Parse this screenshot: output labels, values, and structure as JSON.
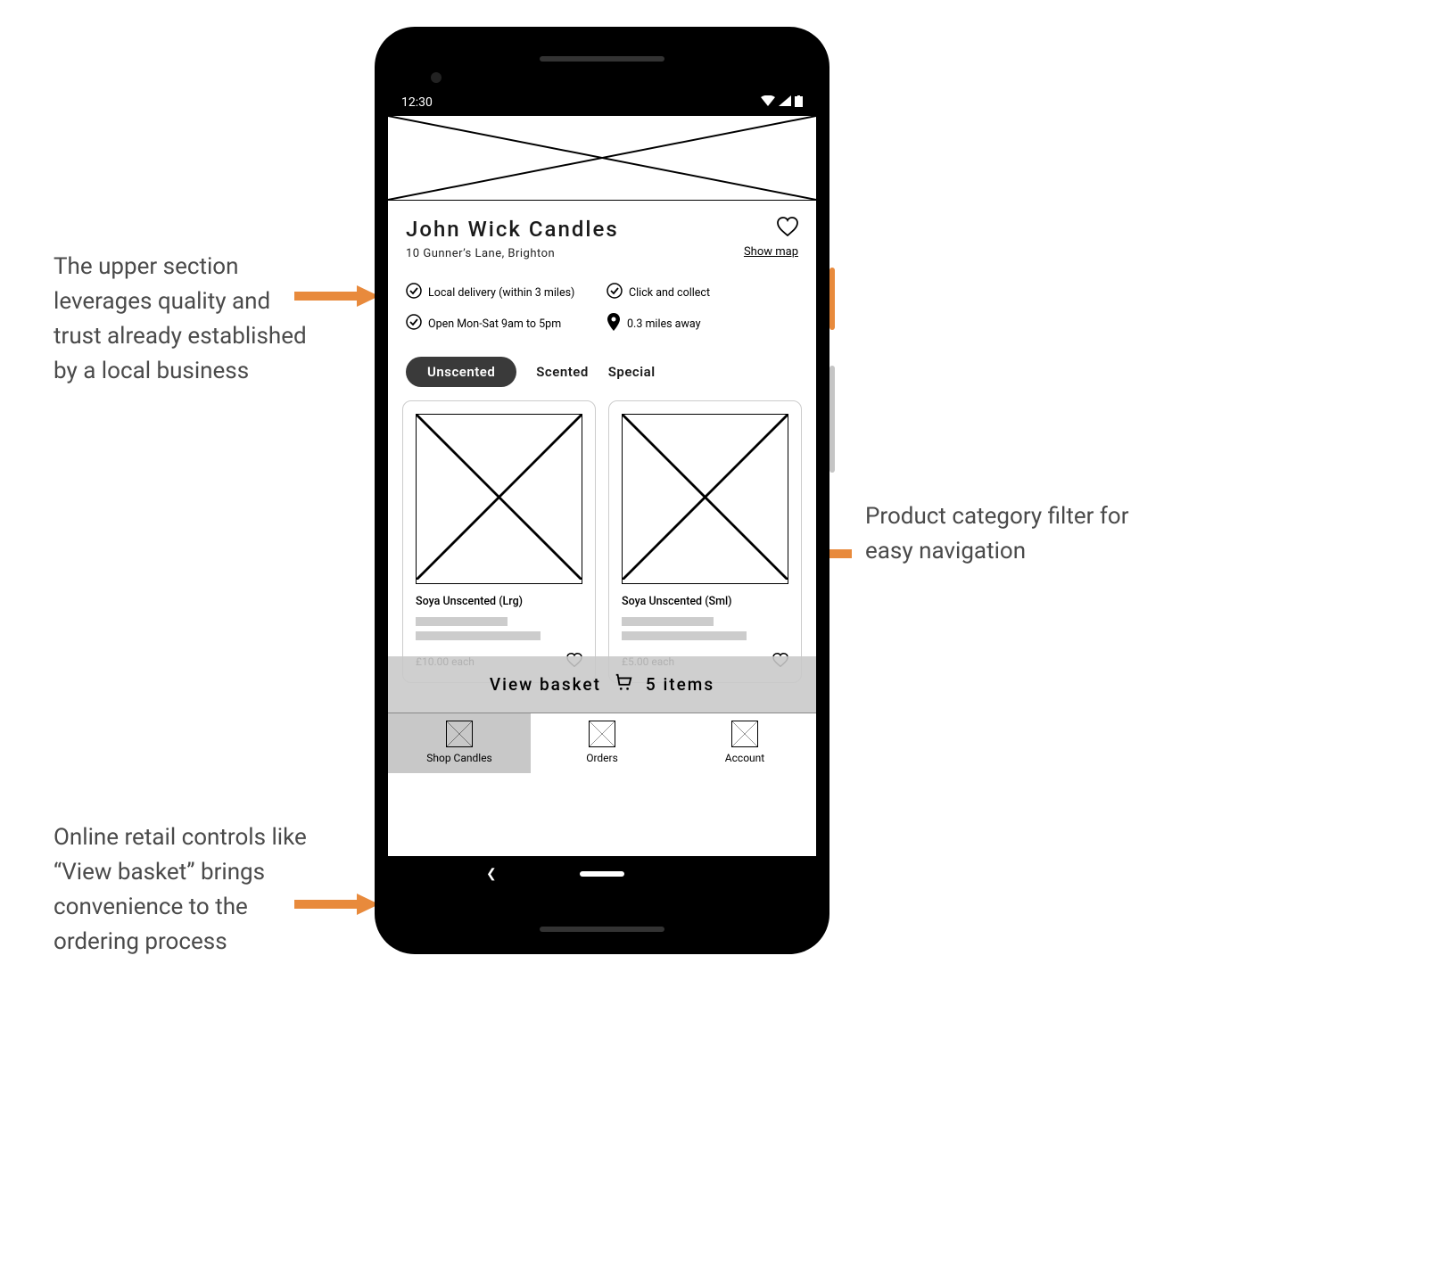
{
  "annotations": {
    "top": "The upper section leverages quality and trust already established by a local business",
    "right": "Product category filter for easy navigation",
    "bottom": "Online retail controls like “View basket” brings convenience to the ordering process"
  },
  "status": {
    "time": "12:30"
  },
  "shop": {
    "name": "John Wick Candles",
    "address": "10 Gunner’s Lane, Brighton",
    "show_map": "Show map"
  },
  "info": {
    "delivery": "Local delivery (within 3 miles)",
    "click_collect": "Click and collect",
    "hours": "Open Mon-Sat 9am to 5pm",
    "distance": "0.3 miles away"
  },
  "tabs": {
    "unscented": "Unscented",
    "scented": "Scented",
    "special": "Special"
  },
  "products": [
    {
      "name": "Soya Unscented (Lrg)",
      "price": "£10.00 each"
    },
    {
      "name": "Soya Unscented (Sml)",
      "price": "£5.00 each"
    }
  ],
  "basket": {
    "label": "View basket",
    "count": "5 items"
  },
  "nav": {
    "shop": "Shop Candles",
    "orders": "Orders",
    "account": "Account"
  }
}
